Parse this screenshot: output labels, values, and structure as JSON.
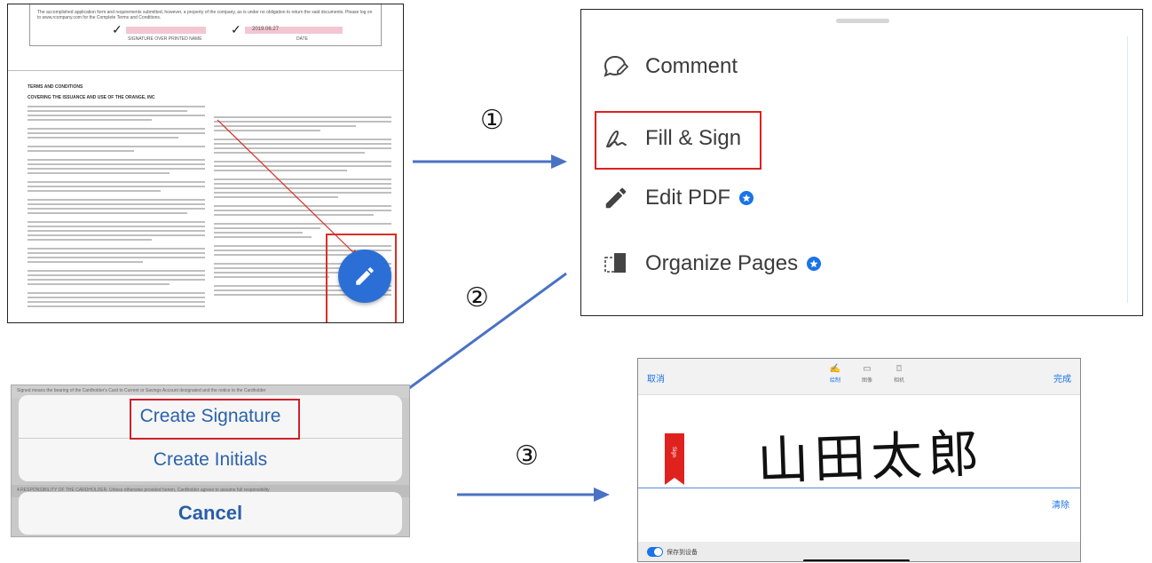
{
  "steps": [
    "①",
    "②",
    "③"
  ],
  "document": {
    "fine_print": "The accomplished application form and requirements submitted, however, a property of the company, as is under no obligation to return the said documents. Please log on to www.rcompany.com for the Complete Terms and Conditions.",
    "sig_caption_left": "SIGNATURE OVER PRINTED NAME",
    "sig_caption_right": "DATE",
    "date_value": "2019.06.27",
    "terms_title": "TERMS AND CONDITIONS",
    "terms_subtitle": "COVERING THE ISSUANCE AND USE OF THE ORANGE, INC",
    "edit_icon": "pencil-icon"
  },
  "menu": {
    "items": [
      {
        "label": "Comment",
        "icon": "comment-icon",
        "premium": false
      },
      {
        "label": "Fill & Sign",
        "icon": "fill-sign-icon",
        "premium": false
      },
      {
        "label": "Edit PDF",
        "icon": "pencil-icon",
        "premium": true
      },
      {
        "label": "Organize Pages",
        "icon": "organize-pages-icon",
        "premium": true
      }
    ]
  },
  "action_sheet": {
    "create_signature": "Create Signature",
    "create_initials": "Create Initials",
    "cancel": "Cancel",
    "bg_text_top": "Signed means the bearing of the Cardholder's Card to Current or Savings Account designated and the notice to the Cardholder",
    "bg_text_bottom": "4.RESPONSIBILITY OF THE CARDHOLDER. Unless otherwise provided herein, Cardholder agrees to assume full responsibility"
  },
  "signature_pad": {
    "cancel": "取消",
    "done": "完成",
    "modes": [
      {
        "label": "绘制",
        "icon": "draw-icon"
      },
      {
        "label": "图像",
        "icon": "image-icon"
      },
      {
        "label": "相机",
        "icon": "camera-icon"
      }
    ],
    "signature": "山田太郎",
    "clear": "清除",
    "save_label": "保存到设备",
    "ribbon_text": "Sign"
  },
  "colors": {
    "accent_blue": "#2b6fd6",
    "highlight_red": "#e02020",
    "arrow_blue": "#4a72c4"
  }
}
